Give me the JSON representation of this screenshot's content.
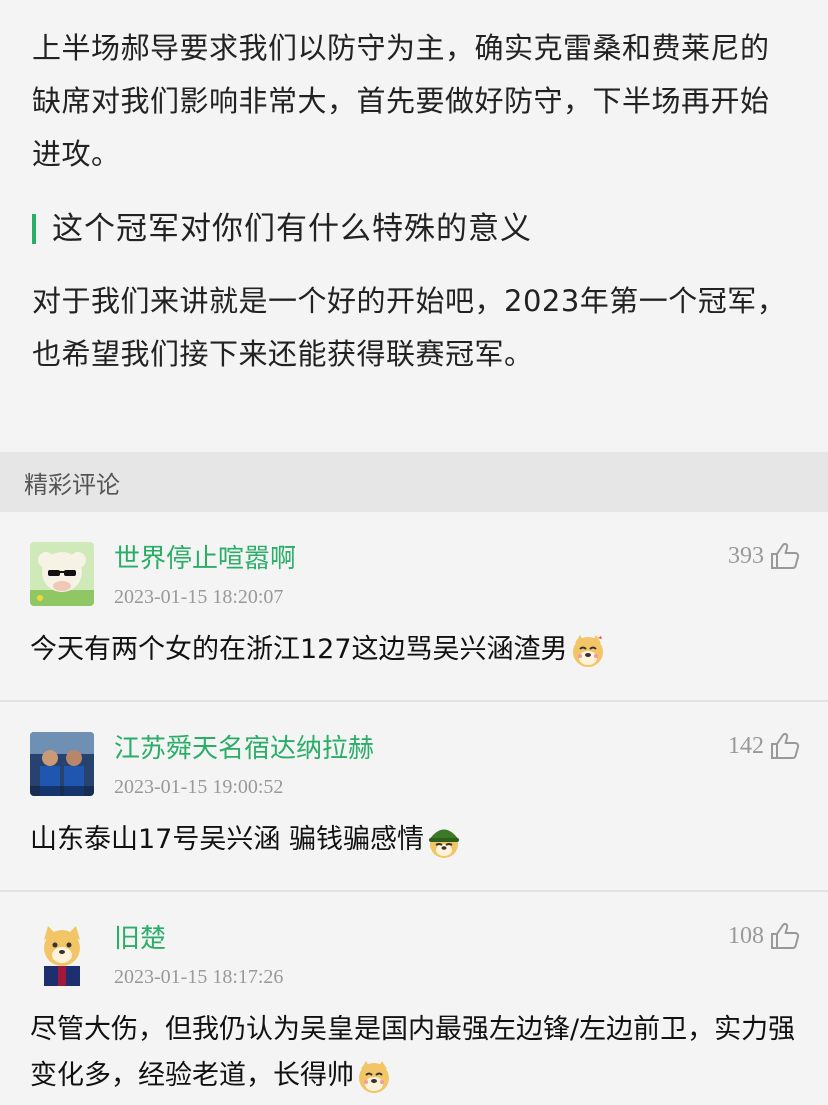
{
  "article": {
    "paragraph1": "上半场郝导要求我们以防守为主，确实克雷桑和费莱尼的缺席对我们影响非常大，首先要做好防守，下半场再开始进攻。",
    "subheading": "这个冠军对你们有什么特殊的意义",
    "paragraph2": "对于我们来讲就是一个好的开始吧，2023年第一个冠军，也希望我们接下来还能获得联赛冠军。"
  },
  "comments_section": {
    "title": "精彩评论",
    "items": [
      {
        "name": "世界停止喧嚣啊",
        "time": "2023-01-15 18:20:07",
        "likes": "393",
        "text": "今天有两个女的在浙江127这边骂吴兴涵渣男",
        "emoji": "doge-emoji"
      },
      {
        "name": "江苏舜天名宿达纳拉赫",
        "time": "2023-01-15 19:00:52",
        "likes": "142",
        "text": "山东泰山17号吴兴涵 骗钱骗感情",
        "emoji": "doge-helmet-emoji"
      },
      {
        "name": "旧楚",
        "time": "2023-01-15 18:17:26",
        "likes": "108",
        "text": "尽管大伤，但我仍认为吴皇是国内最强左边锋/左边前卫，实力强变化多，经验老道，长得帅",
        "emoji": "doge-emoji"
      }
    ]
  },
  "colors": {
    "accent_green": "#2aae67",
    "page_bg": "#f4f4f4",
    "section_bg": "#e6e6e6"
  },
  "icons": {
    "like": "thumbs-up-icon"
  }
}
